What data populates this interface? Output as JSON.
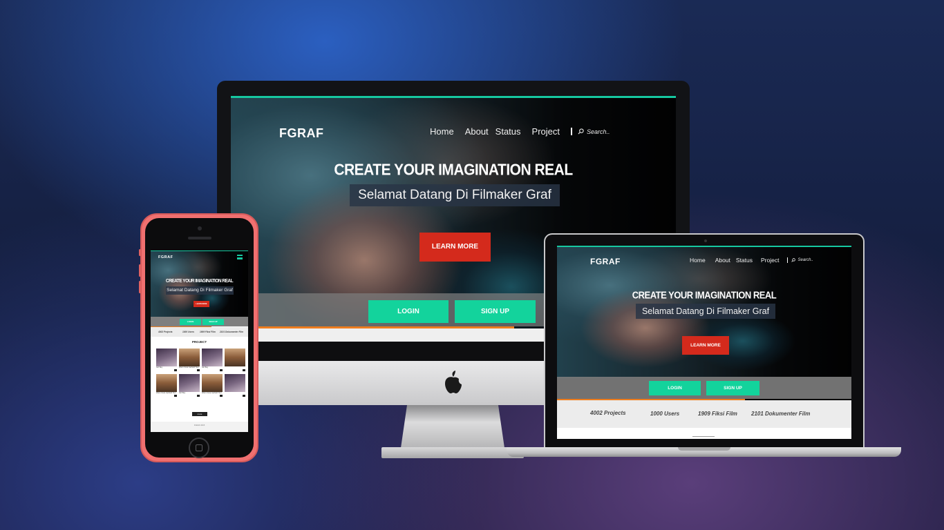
{
  "site": {
    "brand": "FGRAF",
    "nav": [
      "Home",
      "About",
      "Status",
      "Project"
    ],
    "search_placeholder": "Search..",
    "hero_title": "CREATE YOUR IMAGINATION REAL",
    "hero_subtitle": "Selamat Datang Di Filmaker Graf",
    "learn_more": "LEARN MORE",
    "login": "LOGIN",
    "signup": "SIGN UP",
    "stats": [
      "4002 Projects",
      "1000 Users",
      "1909 Fiksi Film",
      "2101 Dokumenter Film"
    ],
    "project_heading": "PROJECT"
  },
  "phone_site": {
    "stats": [
      "4002 Projects",
      "1000 Users",
      "1909 Fiksi Film",
      "2101 Dokumenter Film"
    ],
    "cards": [
      "Girl Boy",
      "Warm Dara Garfield Tour",
      "Girl Boy",
      "",
      "Warm Dara Garfield Tour",
      "Girl Boy",
      "Warm Dara Garfield Tour",
      ""
    ],
    "more_label": "more",
    "footer": "FGRAF 2015"
  },
  "colors": {
    "accent_teal": "#16c8a0",
    "button_green": "#13d39c",
    "button_red": "#d42a1c",
    "divider_orange": "#ee7d1e"
  },
  "icons": {
    "imac_logo": "apple-logo-icon",
    "search": "search-icon",
    "menu": "hamburger-menu-icon"
  }
}
